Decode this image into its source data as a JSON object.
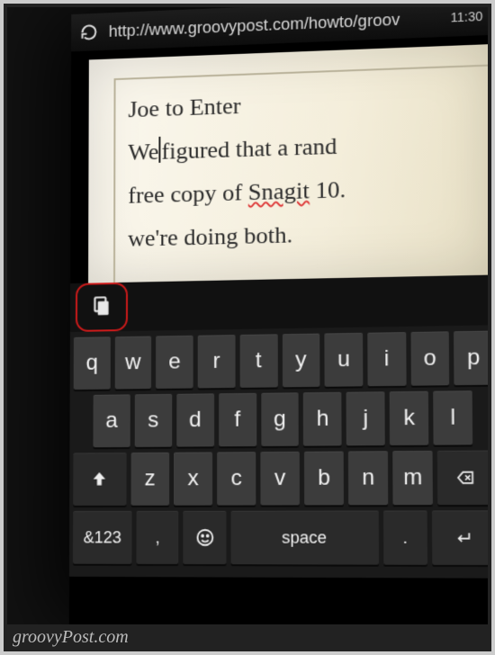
{
  "addressbar": {
    "url": "http://www.groovypost.com/howto/groov",
    "time": "11:30"
  },
  "editor": {
    "line1_a": "Joe to Enter",
    "line2_a": "We",
    "line2_b": "figured that a rand",
    "line3_a": "free copy of ",
    "line3_spell": "Snagit",
    "line3_b": " 10.",
    "line4_a": "we're doing both."
  },
  "keyboard": {
    "row1": [
      "q",
      "w",
      "e",
      "r",
      "t",
      "y",
      "u",
      "i",
      "o",
      "p"
    ],
    "row2": [
      "a",
      "s",
      "d",
      "f",
      "g",
      "h",
      "j",
      "k",
      "l"
    ],
    "row3_mid": [
      "z",
      "x",
      "c",
      "v",
      "b",
      "n",
      "m"
    ],
    "symbols_label": "&123",
    "comma": ",",
    "space_label": "space",
    "period": "."
  },
  "watermark": "groovyPost.com"
}
